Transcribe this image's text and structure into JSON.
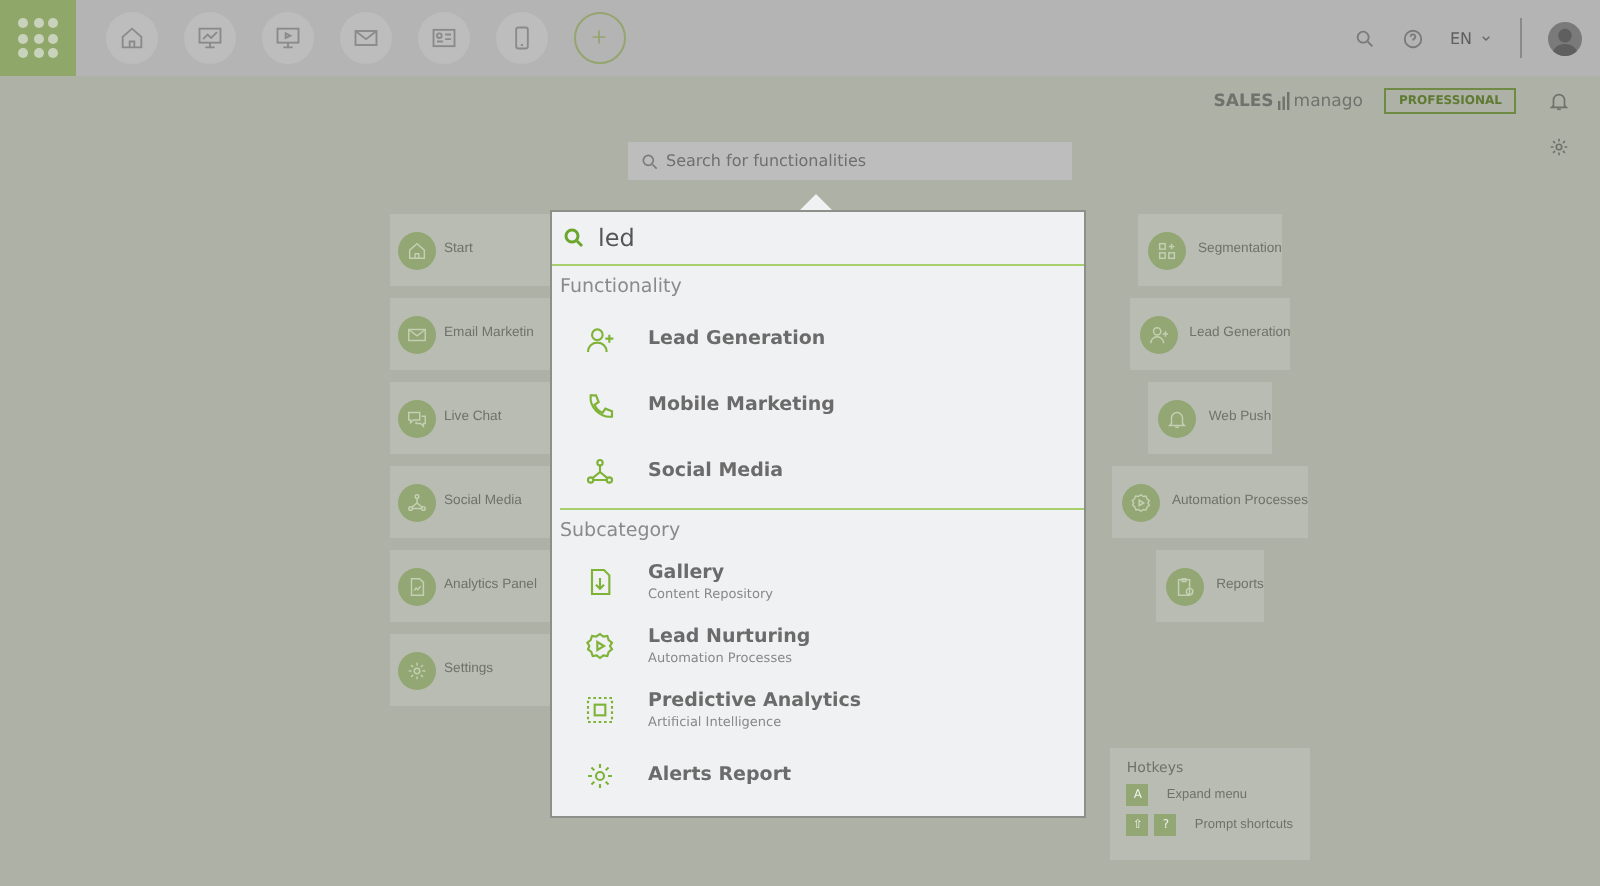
{
  "topbar": {
    "language": "EN"
  },
  "brand": {
    "logo_left": "SALES",
    "logo_right": "manago",
    "plan": "PROFESSIONAL"
  },
  "search": {
    "placeholder": "Search for functionalities"
  },
  "tiles_left": [
    {
      "label": "Start"
    },
    {
      "label": "Email Marketin"
    },
    {
      "label": "Live Chat"
    },
    {
      "label": "Social Media"
    },
    {
      "label": "Analytics Panel"
    },
    {
      "label": "Settings"
    }
  ],
  "tiles_right": [
    {
      "label": "Segmentation"
    },
    {
      "label": "Lead Generation"
    },
    {
      "label": "Web Push"
    },
    {
      "label": "Automation Processes"
    },
    {
      "label": "Reports"
    }
  ],
  "hotkeys": {
    "title": "Hotkeys",
    "rows": [
      {
        "keys": [
          "A"
        ],
        "label": "Expand menu"
      },
      {
        "keys": [
          "⇧",
          "?"
        ],
        "label": "Prompt shortcuts"
      }
    ]
  },
  "popup": {
    "query": "led",
    "sections": [
      {
        "title": "Functionality",
        "items": [
          {
            "title": "Lead Generation"
          },
          {
            "title": "Mobile Marketing"
          },
          {
            "title": "Social Media"
          }
        ]
      },
      {
        "title": "Subcategory",
        "items": [
          {
            "title": "Gallery",
            "subtitle": "Content Repository"
          },
          {
            "title": "Lead Nurturing",
            "subtitle": "Automation Processes"
          },
          {
            "title": "Predictive Analytics",
            "subtitle": "Artificial Intelligence"
          },
          {
            "title": "Alerts Report"
          }
        ]
      }
    ]
  }
}
